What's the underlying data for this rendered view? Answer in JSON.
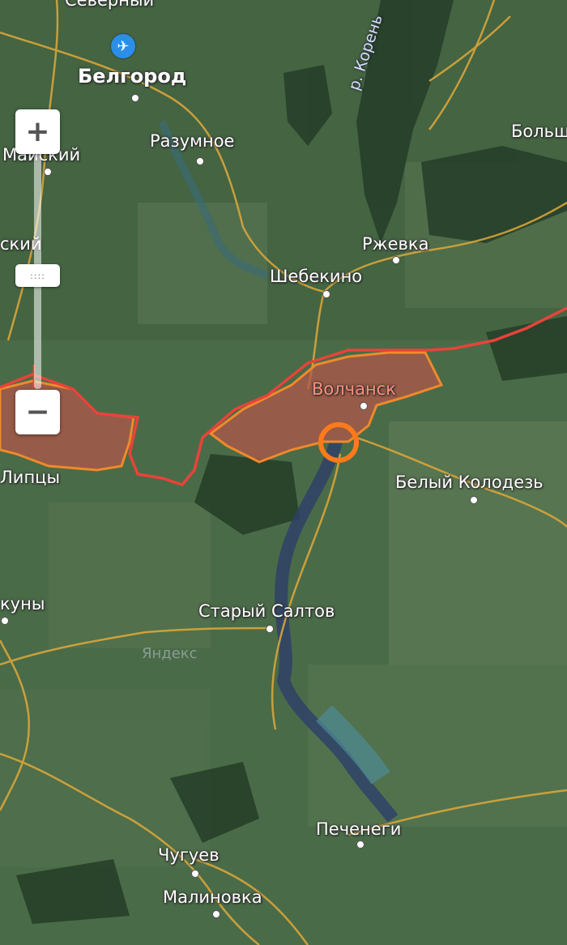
{
  "map": {
    "cities": {
      "severny": "Северный",
      "belgorod": "Белгород",
      "maysky": "Майский",
      "razumnoe": "Разумное",
      "sky": "ский",
      "shebekino": "Шебекино",
      "rzhevka": "Ржевка",
      "bolsh": "Больш",
      "volchansk": "Волчанск",
      "lipcy": "Липцы",
      "bely_kolodez": "Белый Колодезь",
      "kuny": "куны",
      "stary_saltov": "Старый Салтов",
      "pechenegi": "Печенеги",
      "chuguev": "Чугуев",
      "malinovka": "Малиновка"
    },
    "river": "р. Корень",
    "watermark": "Яндекс"
  },
  "controls": {
    "zoom_in": "+",
    "zoom_out": "−",
    "thumb": "::::"
  },
  "icons": {
    "airport": "airplane-icon",
    "marker": "orange-circle-marker"
  },
  "colors": {
    "occupied_fill": "#b5544a",
    "border_red": "#e8433a",
    "border_orange": "#f08a2a",
    "marker": "#ff7a1a",
    "road": "#e0a93a"
  }
}
